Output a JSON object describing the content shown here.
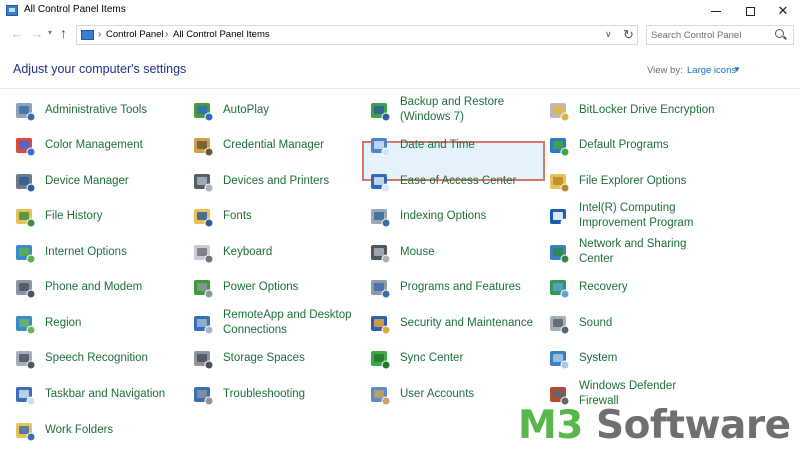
{
  "window": {
    "title": "All Control Panel Items"
  },
  "nav": {
    "breadcrumb": [
      "Control Panel",
      "All Control Panel Items"
    ],
    "search_placeholder": "Search Control Panel"
  },
  "header": {
    "heading": "Adjust your computer's settings",
    "view_by_label": "View by:",
    "view_by_value": "Large icons"
  },
  "items": [
    {
      "label": "Administrative Tools",
      "icon": "admin-tools-icon"
    },
    {
      "label": "AutoPlay",
      "icon": "autoplay-icon"
    },
    {
      "label": "Backup and Restore\n(Windows 7)",
      "icon": "backup-restore-icon"
    },
    {
      "label": "BitLocker Drive Encryption",
      "icon": "bitlocker-icon"
    },
    {
      "label": "Color Management",
      "icon": "color-management-icon"
    },
    {
      "label": "Credential Manager",
      "icon": "credential-manager-icon"
    },
    {
      "label": "Date and Time",
      "icon": "date-time-icon"
    },
    {
      "label": "Default Programs",
      "icon": "default-programs-icon"
    },
    {
      "label": "Device Manager",
      "icon": "device-manager-icon"
    },
    {
      "label": "Devices and Printers",
      "icon": "devices-printers-icon"
    },
    {
      "label": "Ease of Access Center",
      "icon": "ease-of-access-icon"
    },
    {
      "label": "File Explorer Options",
      "icon": "file-explorer-options-icon"
    },
    {
      "label": "File History",
      "icon": "file-history-icon"
    },
    {
      "label": "Fonts",
      "icon": "fonts-icon"
    },
    {
      "label": "Indexing Options",
      "icon": "indexing-options-icon"
    },
    {
      "label": "Intel(R) Computing\nImprovement Program",
      "icon": "intel-icon"
    },
    {
      "label": "Internet Options",
      "icon": "internet-options-icon"
    },
    {
      "label": "Keyboard",
      "icon": "keyboard-icon"
    },
    {
      "label": "Mouse",
      "icon": "mouse-icon"
    },
    {
      "label": "Network and Sharing\nCenter",
      "icon": "network-sharing-icon"
    },
    {
      "label": "Phone and Modem",
      "icon": "phone-modem-icon"
    },
    {
      "label": "Power Options",
      "icon": "power-options-icon"
    },
    {
      "label": "Programs and Features",
      "icon": "programs-features-icon"
    },
    {
      "label": "Recovery",
      "icon": "recovery-icon"
    },
    {
      "label": "Region",
      "icon": "region-icon"
    },
    {
      "label": "RemoteApp and Desktop\nConnections",
      "icon": "remoteapp-icon"
    },
    {
      "label": "Security and Maintenance",
      "icon": "security-maintenance-icon"
    },
    {
      "label": "Sound",
      "icon": "sound-icon"
    },
    {
      "label": "Speech Recognition",
      "icon": "speech-recognition-icon"
    },
    {
      "label": "Storage Spaces",
      "icon": "storage-spaces-icon"
    },
    {
      "label": "Sync Center",
      "icon": "sync-center-icon"
    },
    {
      "label": "System",
      "icon": "system-icon"
    },
    {
      "label": "Taskbar and Navigation",
      "icon": "taskbar-navigation-icon"
    },
    {
      "label": "Troubleshooting",
      "icon": "troubleshooting-icon"
    },
    {
      "label": "User Accounts",
      "icon": "user-accounts-icon"
    },
    {
      "label": "Windows Defender\nFirewall",
      "icon": "windows-firewall-icon"
    },
    {
      "label": "Work Folders",
      "icon": "work-folders-icon"
    }
  ],
  "selected_item": "Date and Time",
  "watermark": {
    "prefix": "M3",
    "suffix": " Software"
  },
  "colors": {
    "link_green": "#1d6f3a",
    "heading_blue": "#1e3287",
    "selection_fill": "#e5f1fb",
    "highlight_border": "#d9766b",
    "watermark_green": "#58b64c",
    "watermark_gray": "#6f6f6f"
  }
}
